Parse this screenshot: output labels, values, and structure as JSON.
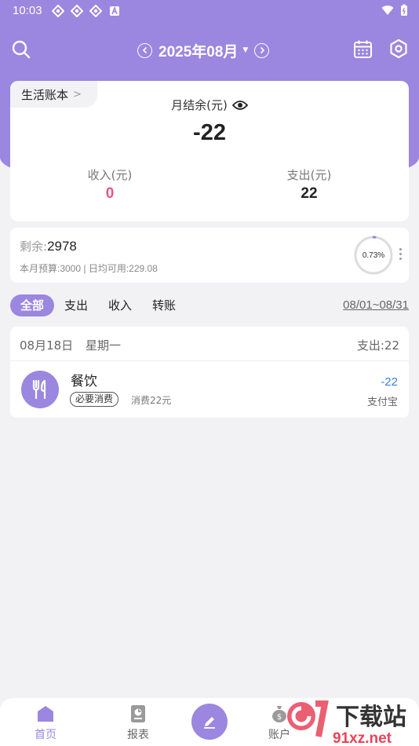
{
  "status_bar": {
    "time": "10:03"
  },
  "header": {
    "month": "2025年08月"
  },
  "summary": {
    "book_name": "生活账本",
    "balance_label": "月结余(元)",
    "balance_value": "-22",
    "income_label": "收入(元)",
    "income_value": "0",
    "expense_label": "支出(元)",
    "expense_value": "22"
  },
  "budget": {
    "remain_label": "剩余:",
    "remain_value": "2978",
    "sub_text": "本月预算:3000 | 日均可用:229.08",
    "percent_text": "0.73%",
    "percent_used": 0.0073
  },
  "filters": {
    "tabs": [
      "全部",
      "支出",
      "收入",
      "转账"
    ],
    "active_index": 0,
    "date_range": "08/01~08/31"
  },
  "day_group": {
    "date": "08月18日",
    "weekday": "星期一",
    "total": "支出:22",
    "transaction": {
      "category": "餐饮",
      "tag": "必要消费",
      "note": "消费22元",
      "amount": "-22",
      "account": "支付宝"
    }
  },
  "bottom_nav": {
    "home": "首页",
    "report": "报表",
    "account": "账户"
  },
  "watermark": {
    "text": "下载站",
    "domain": "91xz.net"
  },
  "colors": {
    "accent": "#9b86e0",
    "income": "#e8577a",
    "amount": "#3b82e0",
    "background": "#f2f2f4"
  }
}
